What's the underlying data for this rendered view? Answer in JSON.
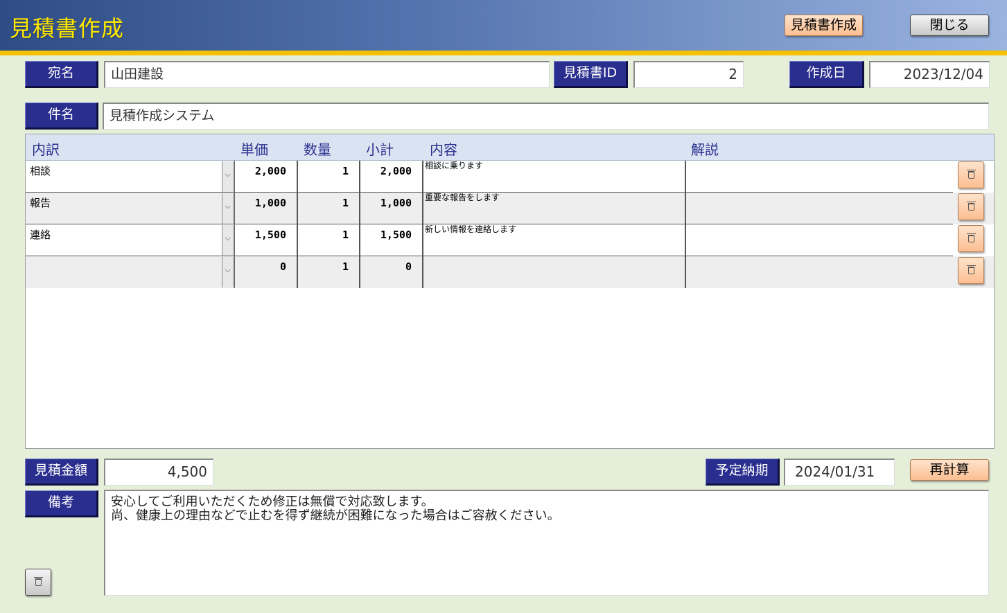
{
  "header": {
    "title": "見積書作成",
    "create_button": "見積書作成",
    "close_button": "閉じる"
  },
  "form": {
    "recipient_label": "宛名",
    "recipient_value": "山田建設",
    "estimate_id_label": "見積書ID",
    "estimate_id_value": "2",
    "created_date_label": "作成日",
    "created_date_value": "2023/12/04",
    "subject_label": "件名",
    "subject_value": "見積作成システム"
  },
  "table": {
    "columns": [
      "内訳",
      "単価",
      "数量",
      "小計",
      "内容",
      "解説"
    ],
    "rows": [
      {
        "item": "相談",
        "unit_price": "2,000",
        "quantity": "1",
        "subtotal": "2,000",
        "content": "相談に乗ります",
        "note": ""
      },
      {
        "item": "報告",
        "unit_price": "1,000",
        "quantity": "1",
        "subtotal": "1,000",
        "content": "重要な報告をします",
        "note": ""
      },
      {
        "item": "連絡",
        "unit_price": "1,500",
        "quantity": "1",
        "subtotal": "1,500",
        "content": "新しい情報を連絡します",
        "note": ""
      },
      {
        "item": "",
        "unit_price": "0",
        "quantity": "1",
        "subtotal": "0",
        "content": "",
        "note": ""
      }
    ]
  },
  "summary": {
    "total_label": "見積金額",
    "total_value": "4,500",
    "due_date_label": "予定納期",
    "due_date_value": "2024/01/31",
    "recalc_button": "再計算"
  },
  "remarks": {
    "label": "備考",
    "lines": [
      "安心してご利用いただくため修正は無償で対応致します。",
      "尚、健康上の理由などで止むを得ず継続が困難になった場合はご容赦ください。"
    ]
  },
  "icons": {
    "dropdown": "chevron-down-icon",
    "delete": "trash-icon"
  },
  "colors": {
    "header_gradient_start": "#2e4c85",
    "header_gradient_end": "#9ab4e0",
    "header_accent_line": "#f5c000",
    "title_text": "#ffe800",
    "label_bg": "#2a2f8f",
    "page_bg": "#e5eed8",
    "button_orange": "#fbbf91"
  }
}
